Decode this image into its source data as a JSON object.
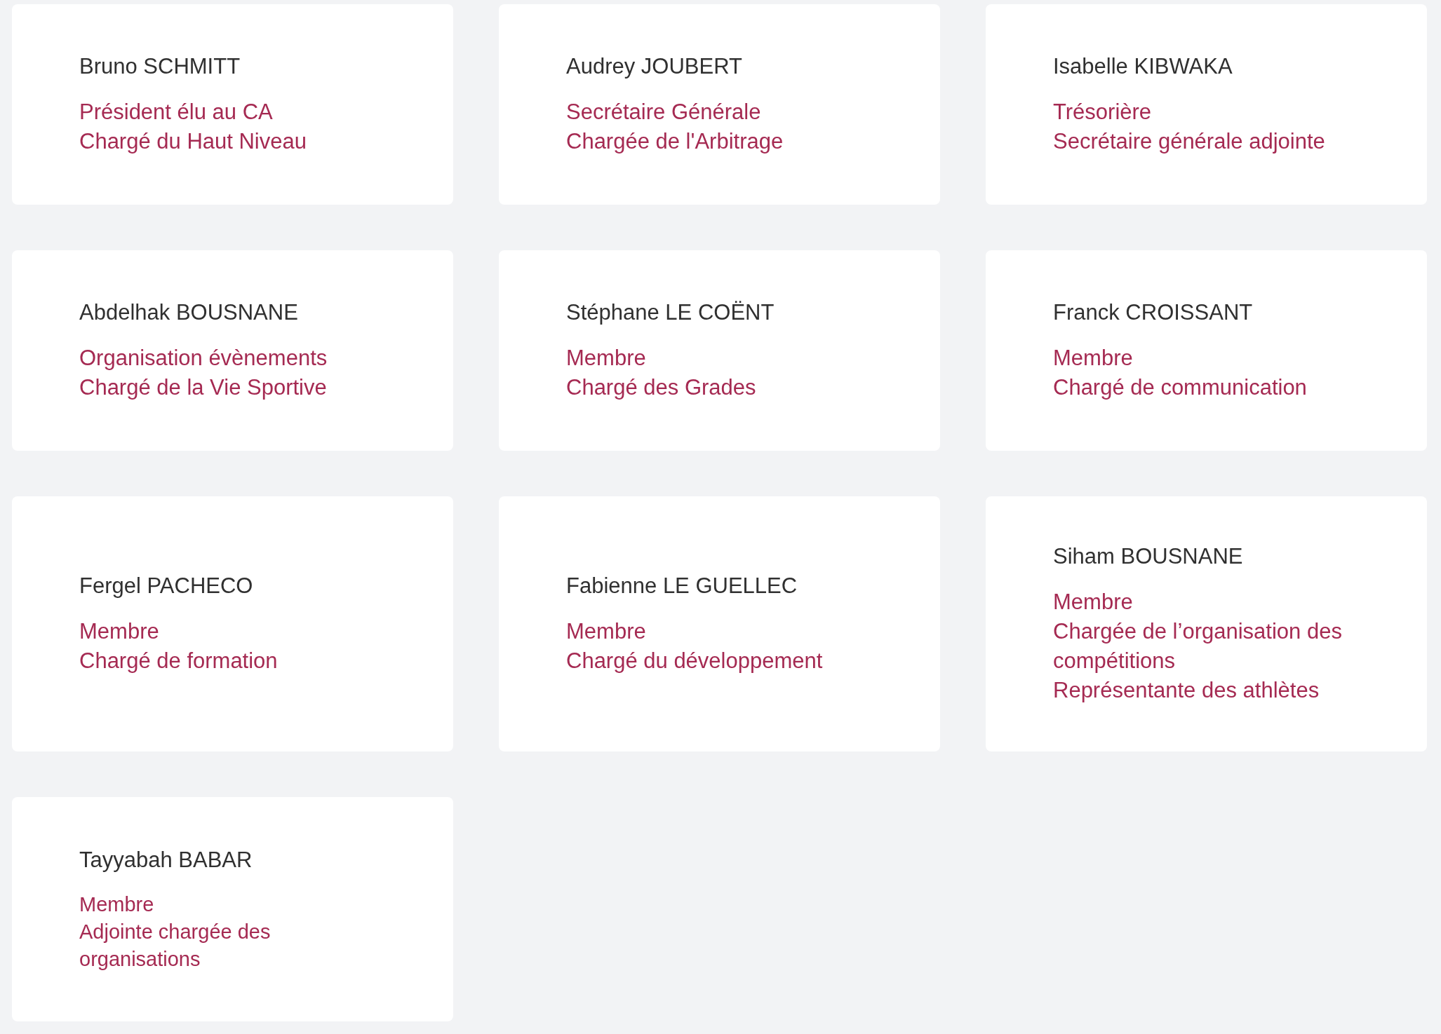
{
  "members": [
    {
      "name": "Bruno SCHMITT",
      "roles": [
        "Président élu au CA",
        "Chargé du Haut Niveau"
      ],
      "compact": false
    },
    {
      "name": "Audrey JOUBERT",
      "roles": [
        "Secrétaire Générale",
        "Chargée de l'Arbitrage"
      ],
      "compact": false
    },
    {
      "name": "Isabelle KIBWAKA",
      "roles": [
        "Trésorière",
        "Secrétaire générale adjointe"
      ],
      "compact": false
    },
    {
      "name": "Abdelhak BOUSNANE",
      "roles": [
        "Organisation évènements",
        "Chargé de la Vie Sportive"
      ],
      "compact": false
    },
    {
      "name": "Stéphane LE COËNT",
      "roles": [
        "Membre",
        "Chargé des Grades"
      ],
      "compact": false
    },
    {
      "name": "Franck CROISSANT",
      "roles": [
        "Membre",
        "Chargé de communication"
      ],
      "compact": false
    },
    {
      "name": "Fergel PACHECO",
      "roles": [
        "Membre",
        "Chargé de formation"
      ],
      "compact": false
    },
    {
      "name": "Fabienne LE GUELLEC",
      "roles": [
        "Membre",
        "Chargé du développement"
      ],
      "compact": false
    },
    {
      "name": "Siham BOUSNANE",
      "roles": [
        "Membre",
        "Chargée de l’organisation des compétitions",
        "Représentante des athlètes"
      ],
      "compact": false
    },
    {
      "name": "Tayyabah BABAR",
      "roles": [
        "Membre",
        "Adjointe chargée des organisations"
      ],
      "compact": true
    }
  ]
}
